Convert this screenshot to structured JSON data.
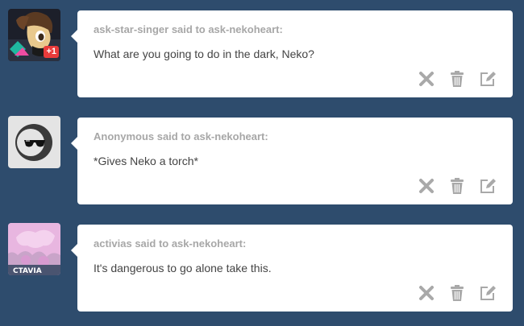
{
  "posts": [
    {
      "asker": "ask-star-singer said to ask-nekoheart:",
      "question": "What are you going to do in the dark, Neko?",
      "avatar_badge": "+1"
    },
    {
      "asker": "Anonymous said to ask-nekoheart:",
      "question": "*Gives Neko a torch*"
    },
    {
      "asker": "activias said to ask-nekoheart:",
      "question": "It's dangerous to go alone take this.",
      "avatar_text": "CTAVIA"
    }
  ],
  "icons": {
    "delete": "close-icon",
    "trash": "trash-icon",
    "edit": "edit-icon"
  },
  "colors": {
    "background": "#2e4c6d",
    "card": "#ffffff",
    "asker_text": "#a7a7a7",
    "question_text": "#444444",
    "icon": "#a9a9a9",
    "badge": "#e93b3b"
  }
}
